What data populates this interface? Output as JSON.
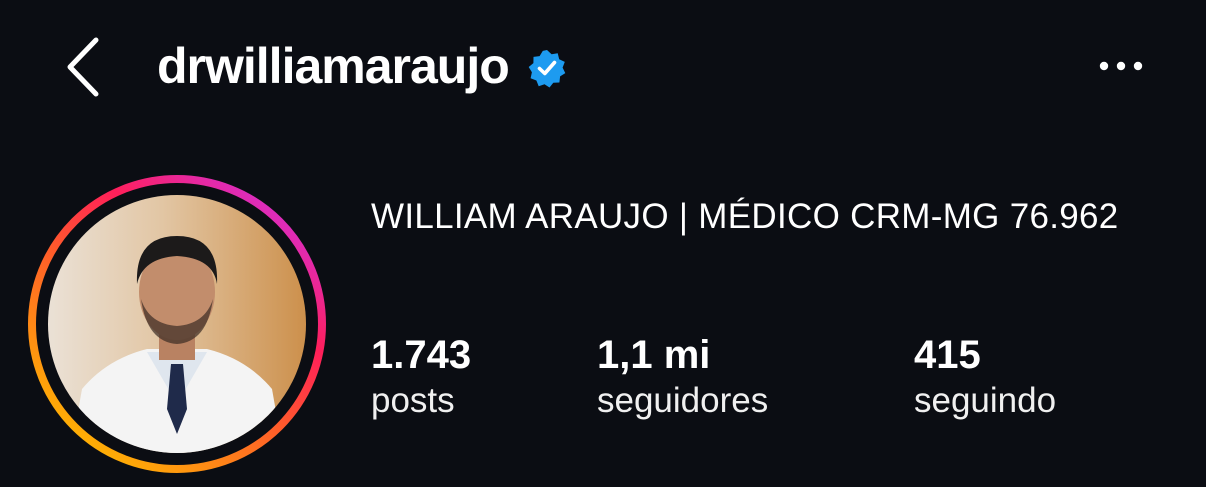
{
  "header": {
    "username": "drwilliamaraujo",
    "verified": true,
    "icons": {
      "back": "chevron-left-icon",
      "verified": "verified-badge-icon",
      "more": "more-horizontal-icon"
    }
  },
  "profile": {
    "display_name": "WILLIAM ARAUJO | MÉDICO CRM-MG 76.962",
    "stats": [
      {
        "value": "1.743",
        "label": "posts"
      },
      {
        "value": "1,1 mi",
        "label": "seguidores"
      },
      {
        "value": "415",
        "label": "seguindo"
      }
    ]
  },
  "colors": {
    "background": "#0b0d13",
    "text": "#ffffff",
    "verified_blue": "#1d9bf0",
    "story_ring_start": "#ffb800",
    "story_ring_mid": "#ff2d55",
    "story_ring_end": "#d62fd0"
  }
}
